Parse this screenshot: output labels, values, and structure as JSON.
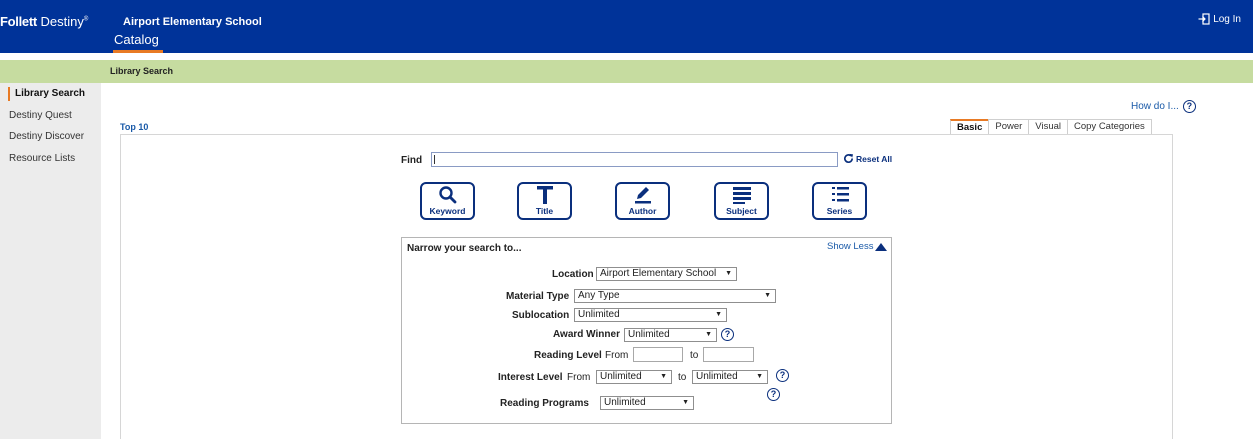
{
  "header": {
    "brand_bold": "Follett",
    "brand_regular": "Destiny",
    "brand_mark": "®",
    "school": "Airport Elementary School",
    "login": "Log In",
    "nav_tab": "Catalog"
  },
  "subheader": {
    "title": "Library Search"
  },
  "sidebar": {
    "items": [
      {
        "label": "Library Search"
      },
      {
        "label": "Destiny Quest"
      },
      {
        "label": "Destiny Discover"
      },
      {
        "label": "Resource Lists"
      }
    ]
  },
  "help": {
    "how_do_i": "How do I...",
    "help_glyph": "?"
  },
  "top10": "Top 10",
  "tabs": [
    "Basic",
    "Power",
    "Visual",
    "Copy Categories"
  ],
  "find": {
    "label": "Find",
    "value": "",
    "reset": "Reset All"
  },
  "search_buttons": [
    {
      "label": "Keyword",
      "icon": "search-icon"
    },
    {
      "label": "Title",
      "icon": "title-t-icon"
    },
    {
      "label": "Author",
      "icon": "pencil-icon"
    },
    {
      "label": "Subject",
      "icon": "lines-icon"
    },
    {
      "label": "Series",
      "icon": "numbered-list-icon"
    }
  ],
  "narrow": {
    "title": "Narrow your search to...",
    "toggle": "Show Less",
    "location": {
      "label": "Location",
      "value": "Airport Elementary School"
    },
    "material_type": {
      "label": "Material Type",
      "value": "Any Type"
    },
    "sublocation": {
      "label": "Sublocation",
      "value": "Unlimited"
    },
    "award_winner": {
      "label": "Award Winner",
      "value": "Unlimited"
    },
    "reading_level": {
      "label": "Reading Level",
      "from": "From",
      "to": "to",
      "from_value": "",
      "to_value": ""
    },
    "interest_level": {
      "label": "Interest Level",
      "from": "From",
      "to": "to",
      "from_value": "Unlimited",
      "to_value": "Unlimited"
    },
    "reading_programs": {
      "label": "Reading Programs",
      "value": "Unlimited"
    }
  },
  "colors": {
    "header_bg": "#003399",
    "accent": "#e87a24",
    "subbar_bg": "#c6dca0",
    "sidebar_bg": "#ececec",
    "link": "#1a5aa8",
    "icon_navy": "#0a2f7d"
  }
}
